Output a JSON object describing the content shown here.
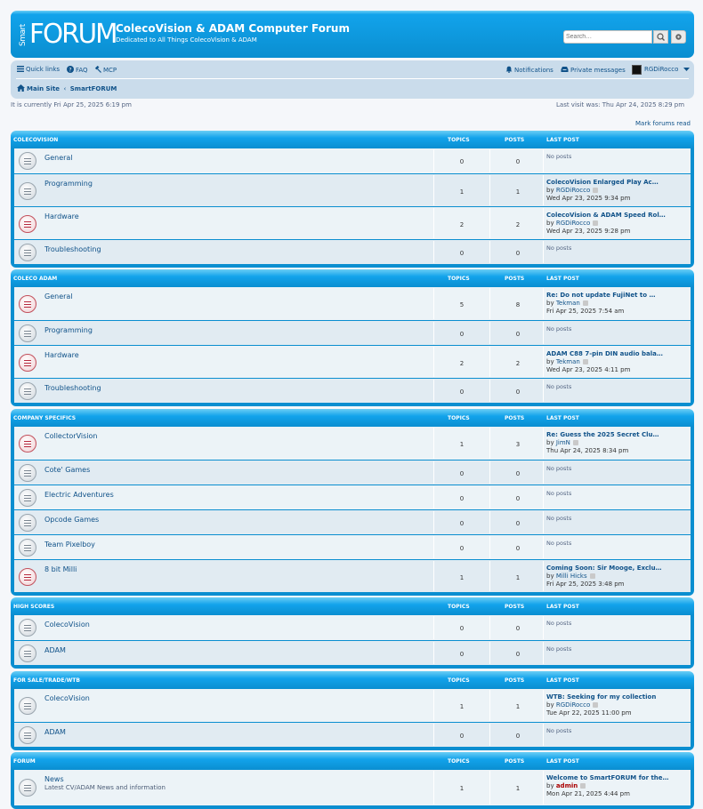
{
  "header": {
    "logo_small": "Smart",
    "logo_big": "FORUM",
    "site_title": "ColecoVision & ADAM Computer Forum",
    "site_desc": "Dedicated to All Things ColecoVision & ADAM",
    "search_placeholder": "Search…",
    "accent": "#0a8ed0"
  },
  "nav": {
    "quick_links": "Quick links",
    "faq": "FAQ",
    "mcp": "MCP",
    "notifications": "Notifications",
    "private_messages": "Private messages",
    "username": "RGDiRocco",
    "crumb_main": "Main Site",
    "crumb_sep": "‹",
    "crumb_forum": "SmartFORUM"
  },
  "info": {
    "current_time": "It is currently Fri Apr 25, 2025 6:19 pm",
    "last_visit": "Last visit was: Thu Apr 24, 2025 8:29 pm",
    "mark_read": "Mark forums read"
  },
  "columns": {
    "topics": "TOPICS",
    "posts": "POSTS",
    "last_post": "LAST POST"
  },
  "sections": [
    {
      "title": "COLECOVISION",
      "forums": [
        {
          "name": "General",
          "topics": "0",
          "posts": "0",
          "unread": false,
          "last_post": "No posts"
        },
        {
          "name": "Programming",
          "topics": "1",
          "posts": "1",
          "unread": false,
          "last_title": "ColecoVision Enlarged Play Ac…",
          "by": "by",
          "author": "RGDiRocco",
          "date": "Wed Apr 23, 2025 9:34 pm"
        },
        {
          "name": "Hardware",
          "topics": "2",
          "posts": "2",
          "unread": true,
          "last_title": "ColecoVision & ADAM Speed Rol…",
          "by": "by",
          "author": "RGDiRocco",
          "date": "Wed Apr 23, 2025 9:28 pm"
        },
        {
          "name": "Troubleshooting",
          "topics": "0",
          "posts": "0",
          "unread": false,
          "last_post": "No posts"
        }
      ]
    },
    {
      "title": "COLECO ADAM",
      "forums": [
        {
          "name": "General",
          "topics": "5",
          "posts": "8",
          "unread": true,
          "last_title": "Re: Do not update FujiNet to …",
          "by": "by",
          "author": "Tekman",
          "date": "Fri Apr 25, 2025 7:54 am"
        },
        {
          "name": "Programming",
          "topics": "0",
          "posts": "0",
          "unread": false,
          "last_post": "No posts"
        },
        {
          "name": "Hardware",
          "topics": "2",
          "posts": "2",
          "unread": true,
          "last_title": "ADAM C88 7-pin DIN audio bala…",
          "by": "by",
          "author": "Tekman",
          "date": "Wed Apr 23, 2025 4:11 pm"
        },
        {
          "name": "Troubleshooting",
          "topics": "0",
          "posts": "0",
          "unread": false,
          "last_post": "No posts"
        }
      ]
    },
    {
      "title": "COMPANY SPECIFICS",
      "forums": [
        {
          "name": "CollectorVision",
          "topics": "1",
          "posts": "3",
          "unread": true,
          "last_title": "Re: Guess the 2025 Secret Clu…",
          "by": "by",
          "author": "JimN",
          "date": "Thu Apr 24, 2025 8:34 pm"
        },
        {
          "name": "Cote' Games",
          "topics": "0",
          "posts": "0",
          "unread": false,
          "last_post": "No posts"
        },
        {
          "name": "Electric Adventures",
          "topics": "0",
          "posts": "0",
          "unread": false,
          "last_post": "No posts"
        },
        {
          "name": "Opcode Games",
          "topics": "0",
          "posts": "0",
          "unread": false,
          "last_post": "No posts"
        },
        {
          "name": "Team Pixelboy",
          "topics": "0",
          "posts": "0",
          "unread": false,
          "last_post": "No posts"
        },
        {
          "name": "8 bit Milli",
          "topics": "1",
          "posts": "1",
          "unread": true,
          "last_title": "Coming Soon: Sir Mooge, Exclu…",
          "by": "by",
          "author": "Milli Hicks",
          "date": "Fri Apr 25, 2025 3:48 pm"
        }
      ]
    },
    {
      "title": "HIGH SCORES",
      "forums": [
        {
          "name": "ColecoVision",
          "topics": "0",
          "posts": "0",
          "unread": false,
          "last_post": "No posts"
        },
        {
          "name": "ADAM",
          "topics": "0",
          "posts": "0",
          "unread": false,
          "last_post": "No posts"
        }
      ]
    },
    {
      "title": "FOR SALE/TRADE/WTB",
      "forums": [
        {
          "name": "ColecoVision",
          "topics": "1",
          "posts": "1",
          "unread": false,
          "last_title": "WTB: Seeking for my collection",
          "by": "by",
          "author": "RGDiRocco",
          "date": "Tue Apr 22, 2025 11:00 pm"
        },
        {
          "name": "ADAM",
          "topics": "0",
          "posts": "0",
          "unread": false,
          "last_post": "No posts"
        }
      ]
    },
    {
      "title": "FORUM",
      "forums": [
        {
          "name": "News",
          "desc": "Latest CV/ADAM News and information",
          "topics": "1",
          "posts": "1",
          "unread": false,
          "last_title": "Welcome to SmartFORUM for the…",
          "by": "by",
          "author": "admin",
          "admin": true,
          "date": "Mon Apr 21, 2025 4:44 pm"
        }
      ]
    }
  ]
}
